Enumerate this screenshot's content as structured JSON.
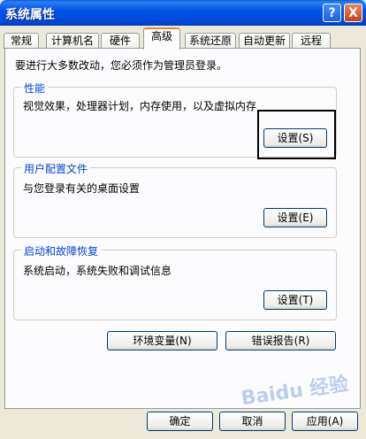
{
  "window": {
    "title": "系统属性",
    "help_icon": "?",
    "close_icon": "X"
  },
  "tabs": [
    "常规",
    "计算机名",
    "硬件",
    "高级",
    "系统还原",
    "自动更新",
    "远程"
  ],
  "note": "要进行大多数改动，您必须作为管理员登录。",
  "groups": {
    "performance": {
      "label": "性能",
      "desc": "视觉效果，处理器计划，内存使用，以及虚拟内存",
      "button": "设置(S)"
    },
    "profiles": {
      "label": "用户配置文件",
      "desc": "与您登录有关的桌面设置",
      "button": "设置(E)"
    },
    "startup": {
      "label": "启动和故障恢复",
      "desc": "系统启动，系统失败和调试信息",
      "button": "设置(T)"
    }
  },
  "buttons": {
    "env": "环境变量(N)",
    "error": "错误报告(R)",
    "ok": "确定",
    "cancel": "取消",
    "apply": "应用(A)"
  },
  "watermark": "Baidu 经验"
}
